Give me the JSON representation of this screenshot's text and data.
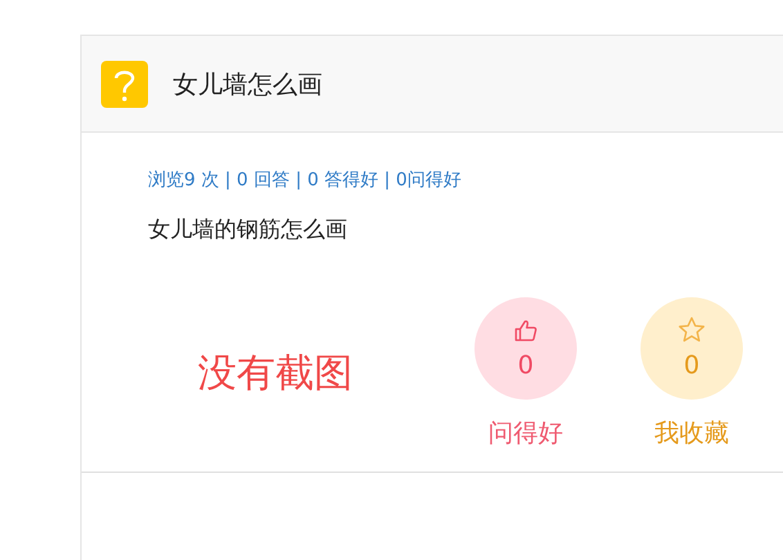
{
  "question": {
    "title": "女儿墙怎么画",
    "stats": "浏览9 次 | 0 回答 | 0 答得好 | 0问得好",
    "body": "女儿墙的钢筋怎么画"
  },
  "screenshot_note": "没有截图",
  "actions": [
    {
      "kind": "like",
      "count": "0",
      "label": "问得好"
    },
    {
      "kind": "favorite",
      "count": "0",
      "label": "我收藏"
    }
  ]
}
